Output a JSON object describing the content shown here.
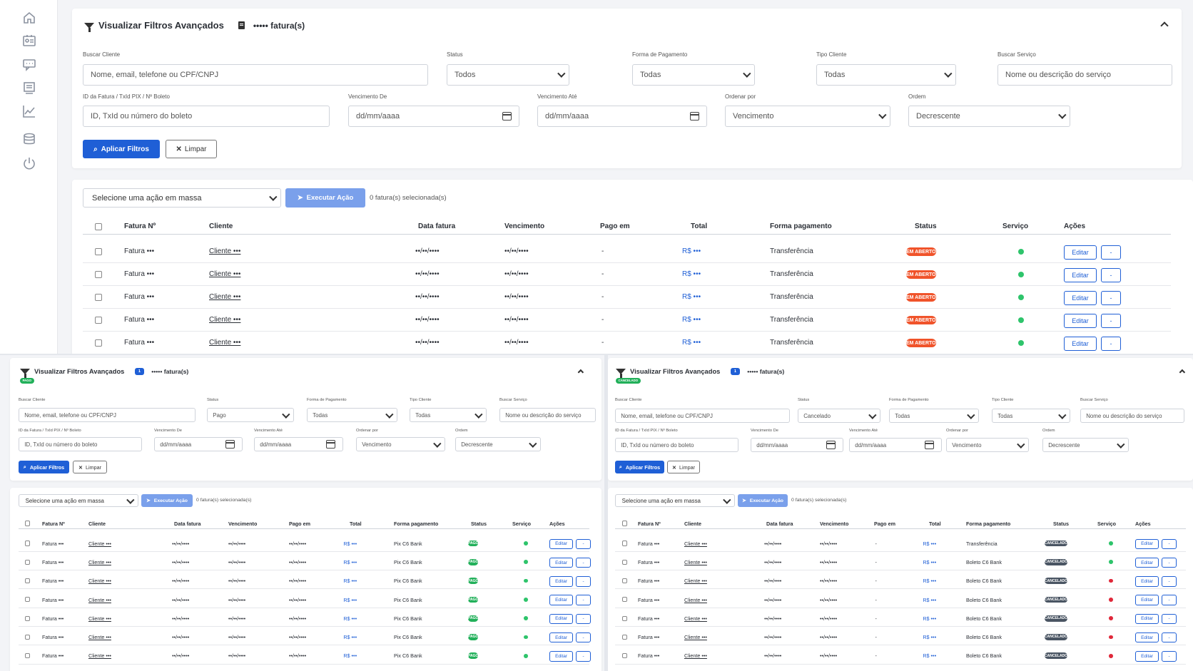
{
  "sidebar": {
    "icons": [
      "home-icon",
      "id-card-icon",
      "chat-icon",
      "invoice-icon",
      "chart-line-icon",
      "database-icon",
      "power-icon"
    ]
  },
  "filter": {
    "title": "Visualizar Filtros Avançados",
    "count_text": "••••• fatura(s)",
    "buscar_cliente_label": "Buscar Cliente",
    "buscar_cliente_placeholder": "Nome, email, telefone ou CPF/CNPJ",
    "status_label": "Status",
    "forma_label": "Forma de Pagamento",
    "forma_value": "Todas",
    "tipo_label": "Tipo Cliente",
    "tipo_value": "Todas",
    "servico_label": "Buscar Serviço",
    "servico_placeholder": "Nome ou descrição do serviço",
    "id_label": "ID da Fatura / TxId PIX / Nº Boleto",
    "id_placeholder": "ID, TxId ou número do boleto",
    "venc_de_label": "Vencimento De",
    "venc_ate_label": "Vencimento Até",
    "date_placeholder": "dd/mm/aaaa",
    "ordenar_label": "Ordenar por",
    "ordenar_value": "Vencimento",
    "ordem_label": "Ordem",
    "ordem_value": "Decrescente",
    "apply_label": "Aplicar Filtros",
    "clear_label": "Limpar"
  },
  "bulk": {
    "select_placeholder": "Selecione uma ação em massa",
    "exec_label": "Executar Ação",
    "selected_info": "0 fatura(s) selecionada(s)"
  },
  "table": {
    "headers": [
      "Fatura Nº",
      "Cliente",
      "Data fatura",
      "Vencimento",
      "Pago em",
      "Total",
      "Forma pagamento",
      "Status",
      "Serviço",
      "Ações"
    ],
    "fatura": "Fatura •••",
    "cliente": "Cliente •••",
    "date_mask": "••/••/••••",
    "dash": "-",
    "total": "R$ •••",
    "edit_label": "Editar",
    "more_label": "-"
  },
  "views": {
    "todos": {
      "status_value": "Todos",
      "rows": [
        {
          "forma": "Transferência",
          "status": "EM ABERTO",
          "servico": "green"
        },
        {
          "forma": "Transferência",
          "status": "EM ABERTO",
          "servico": "green"
        },
        {
          "forma": "Transferência",
          "status": "EM ABERTO",
          "servico": "green"
        },
        {
          "forma": "Transferência",
          "status": "EM ABERTO",
          "servico": "green"
        },
        {
          "forma": "Transferência",
          "status": "EM ABERTO",
          "servico": "green"
        }
      ]
    },
    "pago": {
      "chip": "PAGO",
      "count_badge": "1",
      "status_value": "Pago",
      "rows": [
        {
          "forma": "Pix C6 Bank",
          "status": "PAGO",
          "servico": "green"
        },
        {
          "forma": "Pix C6 Bank",
          "status": "PAGO",
          "servico": "green"
        },
        {
          "forma": "Pix C6 Bank",
          "status": "PAGO",
          "servico": "green"
        },
        {
          "forma": "Pix C6 Bank",
          "status": "PAGO",
          "servico": "green"
        },
        {
          "forma": "Pix C6 Bank",
          "status": "PAGO",
          "servico": "green"
        },
        {
          "forma": "Pix C6 Bank",
          "status": "PAGO",
          "servico": "green"
        },
        {
          "forma": "Pix C6 Bank",
          "status": "PAGO",
          "servico": "green"
        }
      ]
    },
    "cancelado": {
      "chip": "CANCELADO",
      "count_badge": "1",
      "status_value": "Cancelado",
      "rows": [
        {
          "forma": "Transferência",
          "status": "CANCELADO",
          "servico": "green"
        },
        {
          "forma": "Boleto C6 Bank",
          "status": "CANCELADO",
          "servico": "green"
        },
        {
          "forma": "Boleto C6 Bank",
          "status": "CANCELADO",
          "servico": "red"
        },
        {
          "forma": "Boleto C6 Bank",
          "status": "CANCELADO",
          "servico": "red"
        },
        {
          "forma": "Boleto C6 Bank",
          "status": "CANCELADO",
          "servico": "red"
        },
        {
          "forma": "Boleto C6 Bank",
          "status": "CANCELADO",
          "servico": "red"
        },
        {
          "forma": "Boleto C6 Bank",
          "status": "CANCELADO",
          "servico": "red"
        }
      ]
    }
  },
  "colors": {
    "primary": "#1f5fd6",
    "open": "#f0532a",
    "paid": "#22b05a",
    "cancel": "#4a5563",
    "green": "#2ec46b",
    "red": "#e0283a"
  }
}
